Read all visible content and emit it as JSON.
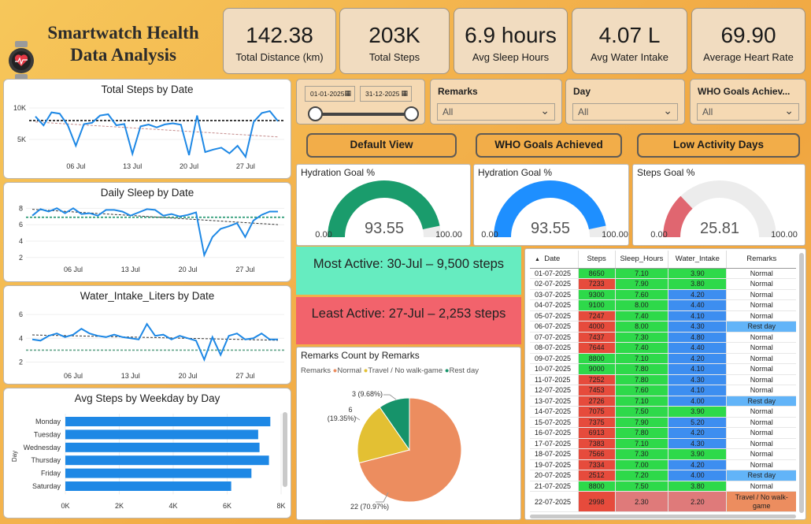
{
  "header": {
    "title_line1": "Smartwatch Health",
    "title_line2": "Data Analysis",
    "kpis": [
      {
        "value": "142.38",
        "label": "Total Distance (km)"
      },
      {
        "value": "203K",
        "label": "Total Steps"
      },
      {
        "value": "6.9 hours",
        "label": "Avg Sleep Hours"
      },
      {
        "value": "4.07 L",
        "label": "Avg Water Intake"
      },
      {
        "value": "69.90",
        "label": "Average Heart Rate"
      }
    ]
  },
  "filters": {
    "date_start": "01-01-2025",
    "date_end": "31-12-2025",
    "remarks": {
      "label": "Remarks",
      "value": "All"
    },
    "day": {
      "label": "Day",
      "value": "All"
    },
    "who": {
      "label": "WHO Goals Achiev...",
      "value": "All"
    }
  },
  "buttons": {
    "default_view": "Default View",
    "who_goals": "WHO Goals Achieved",
    "low_activity": "Low Activity Days"
  },
  "gauges": [
    {
      "title": "Hydration Goal %",
      "value": 93.55,
      "display": "93.55",
      "min": "0.00",
      "max": "100.00",
      "color": "#1a9c6c"
    },
    {
      "title": "Hydration Goal %",
      "value": 93.55,
      "display": "93.55",
      "min": "0.00",
      "max": "100.00",
      "color": "#1e8fff"
    },
    {
      "title": "Steps Goal %",
      "value": 25.81,
      "display": "25.81",
      "min": "0.00",
      "max": "100.00",
      "color": "#e06670"
    }
  ],
  "bands": {
    "most_active": "Most Active: 30-Jul – 9,500 steps",
    "least_active": "Least Active: 27-Jul – 2,253 steps"
  },
  "colors": {
    "line": "#1e88e5",
    "bar": "#1e88e5",
    "most_active_bg": "#66ecc0",
    "least_active_bg": "#f2636c",
    "cell_green": "#2ed94a",
    "cell_red": "#e64b3c",
    "cell_blue": "#3d8ef0",
    "cell_rest": "#62b4f8",
    "pie_normal": "#ec8d5f",
    "pie_travel": "#e3c033",
    "pie_rest": "#16936a"
  },
  "chart_data": [
    {
      "type": "line",
      "title": "Total Steps by Date",
      "x_ticks": [
        "06 Jul",
        "13 Jul",
        "20 Jul",
        "27 Jul"
      ],
      "y_ticks": [
        "10K",
        "5K"
      ],
      "ylim": [
        2000,
        11000
      ],
      "reference_value": 8000,
      "values": [
        8650,
        7233,
        9300,
        9100,
        7247,
        4000,
        7437,
        7644,
        8800,
        9000,
        7252,
        7453,
        2726,
        7075,
        7375,
        6913,
        7383,
        7566,
        7334,
        2512,
        8800,
        2998,
        3400,
        3700,
        2800,
        4000,
        2253,
        7800,
        9200,
        9500,
        7900
      ]
    },
    {
      "type": "line",
      "title": "Daily Sleep by Date",
      "x_ticks": [
        "06 Jul",
        "13 Jul",
        "20 Jul",
        "27 Jul"
      ],
      "y_ticks": [
        "8",
        "6",
        "4",
        "2"
      ],
      "ylim": [
        1.5,
        8.8
      ],
      "reference_value": 6.9,
      "values": [
        7.1,
        7.9,
        7.6,
        8.0,
        7.4,
        8.0,
        7.3,
        7.4,
        7.1,
        7.8,
        7.8,
        7.6,
        7.1,
        7.5,
        7.9,
        7.8,
        7.1,
        7.3,
        7.0,
        7.2,
        7.5,
        2.3,
        4.5,
        5.5,
        5.8,
        6.2,
        4.5,
        6.5,
        7.2,
        7.6,
        7.6
      ]
    },
    {
      "type": "line",
      "title": "Water_Intake_Liters by Date",
      "x_ticks": [
        "06 Jul",
        "13 Jul",
        "20 Jul",
        "27 Jul"
      ],
      "y_ticks": [
        "6",
        "4",
        "2"
      ],
      "ylim": [
        1.5,
        6.8
      ],
      "reference_value": 3,
      "values": [
        3.9,
        3.8,
        4.2,
        4.4,
        4.1,
        4.3,
        4.8,
        4.4,
        4.2,
        4.1,
        4.3,
        4.1,
        4.0,
        3.9,
        5.2,
        4.2,
        4.3,
        3.9,
        4.2,
        4.0,
        3.8,
        2.2,
        4.1,
        2.6,
        4.2,
        4.4,
        3.9,
        4.0,
        4.4,
        3.9,
        3.9
      ]
    },
    {
      "type": "bar",
      "title": "Avg Steps by Weekday by Day",
      "ylabel": "Day",
      "categories": [
        "Monday",
        "Tuesday",
        "Wednesday",
        "Thursday",
        "Friday",
        "Saturday"
      ],
      "values": [
        7600,
        7150,
        7200,
        7550,
        6900,
        6150
      ],
      "x_ticks": [
        "0K",
        "2K",
        "4K",
        "6K",
        "8K"
      ],
      "xlim": [
        0,
        8000
      ]
    },
    {
      "type": "pie",
      "title": "Remarks Count by Remarks",
      "legend_title": "Remarks",
      "slices": [
        {
          "name": "Normal",
          "value": 22,
          "label": "22 (70.97%)"
        },
        {
          "name": "Travel / No walk-game",
          "value": 6,
          "label_line1": "6",
          "label_line2": "(19.35%)"
        },
        {
          "name": "Rest day",
          "value": 3,
          "label": "3 (9.68%)"
        }
      ]
    },
    {
      "type": "table",
      "columns": [
        "Date",
        "Steps",
        "Sleep_Hours",
        "Water_Intake",
        "Remarks"
      ],
      "rows": [
        [
          "01-07-2025",
          "8650",
          "7.10",
          "3.90",
          "Normal"
        ],
        [
          "02-07-2025",
          "7233",
          "7.90",
          "3.80",
          "Normal"
        ],
        [
          "03-07-2025",
          "9300",
          "7.60",
          "4.20",
          "Normal"
        ],
        [
          "04-07-2025",
          "9100",
          "8.00",
          "4.40",
          "Normal"
        ],
        [
          "05-07-2025",
          "7247",
          "7.40",
          "4.10",
          "Normal"
        ],
        [
          "06-07-2025",
          "4000",
          "8.00",
          "4.30",
          "Rest day"
        ],
        [
          "07-07-2025",
          "7437",
          "7.30",
          "4.80",
          "Normal"
        ],
        [
          "08-07-2025",
          "7644",
          "7.40",
          "4.40",
          "Normal"
        ],
        [
          "09-07-2025",
          "8800",
          "7.10",
          "4.20",
          "Normal"
        ],
        [
          "10-07-2025",
          "9000",
          "7.80",
          "4.10",
          "Normal"
        ],
        [
          "11-07-2025",
          "7252",
          "7.80",
          "4.30",
          "Normal"
        ],
        [
          "12-07-2025",
          "7453",
          "7.60",
          "4.10",
          "Normal"
        ],
        [
          "13-07-2025",
          "2726",
          "7.10",
          "4.00",
          "Rest day"
        ],
        [
          "14-07-2025",
          "7075",
          "7.50",
          "3.90",
          "Normal"
        ],
        [
          "15-07-2025",
          "7375",
          "7.90",
          "5.20",
          "Normal"
        ],
        [
          "16-07-2025",
          "6913",
          "7.80",
          "4.20",
          "Normal"
        ],
        [
          "17-07-2025",
          "7383",
          "7.10",
          "4.30",
          "Normal"
        ],
        [
          "18-07-2025",
          "7566",
          "7.30",
          "3.90",
          "Normal"
        ],
        [
          "19-07-2025",
          "7334",
          "7.00",
          "4.20",
          "Normal"
        ],
        [
          "20-07-2025",
          "2512",
          "7.20",
          "4.00",
          "Rest day"
        ],
        [
          "21-07-2025",
          "8800",
          "7.50",
          "3.80",
          "Normal"
        ],
        [
          "22-07-2025",
          "2998",
          "2.30",
          "2.20",
          "Travel / No walk-game"
        ]
      ]
    }
  ]
}
